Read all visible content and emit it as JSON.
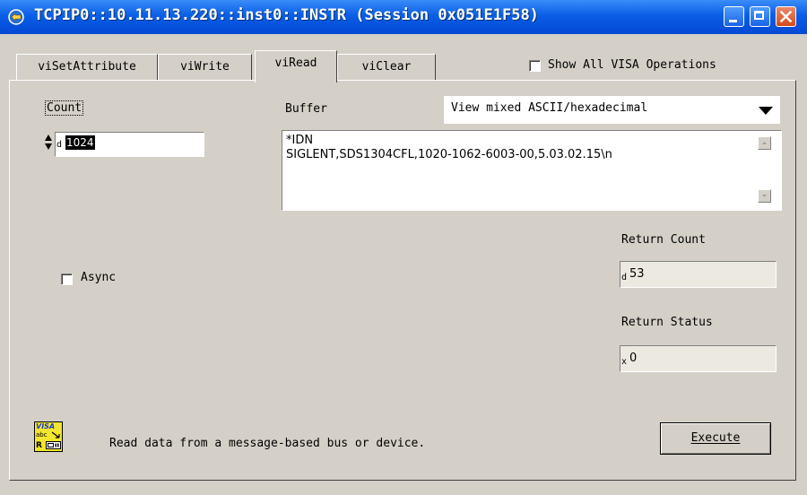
{
  "window": {
    "title": "TCPIP0::10.11.13.220::inst0::INSTR (Session 0x051E1F58)"
  },
  "tabs": [
    {
      "label": "viSetAttribute",
      "active": false
    },
    {
      "label": "viWrite",
      "active": false
    },
    {
      "label": "viRead",
      "active": true
    },
    {
      "label": "viClear",
      "active": false
    }
  ],
  "show_all_visa": {
    "label": "Show All VISA Operations",
    "checked": false
  },
  "count": {
    "label": "Count",
    "radix": "d",
    "value": "1024"
  },
  "buffer": {
    "label": "Buffer",
    "view_mode": "View mixed ASCII/hexadecimal",
    "line1": "*IDN",
    "line2": "SIGLENT,SDS1304CFL,1020-1062-6003-00,5.03.02.15\\n"
  },
  "async": {
    "label": "Async",
    "checked": false
  },
  "return_count": {
    "label": "Return Count",
    "radix": "d",
    "value": "53"
  },
  "return_status": {
    "label": "Return Status",
    "radix": "x",
    "value": "0"
  },
  "footer": {
    "icon_line1": "VISA",
    "icon_line2": "abc",
    "icon_line3": "R",
    "description": "Read data from a message-based bus or device.",
    "execute_label": "Execute"
  }
}
